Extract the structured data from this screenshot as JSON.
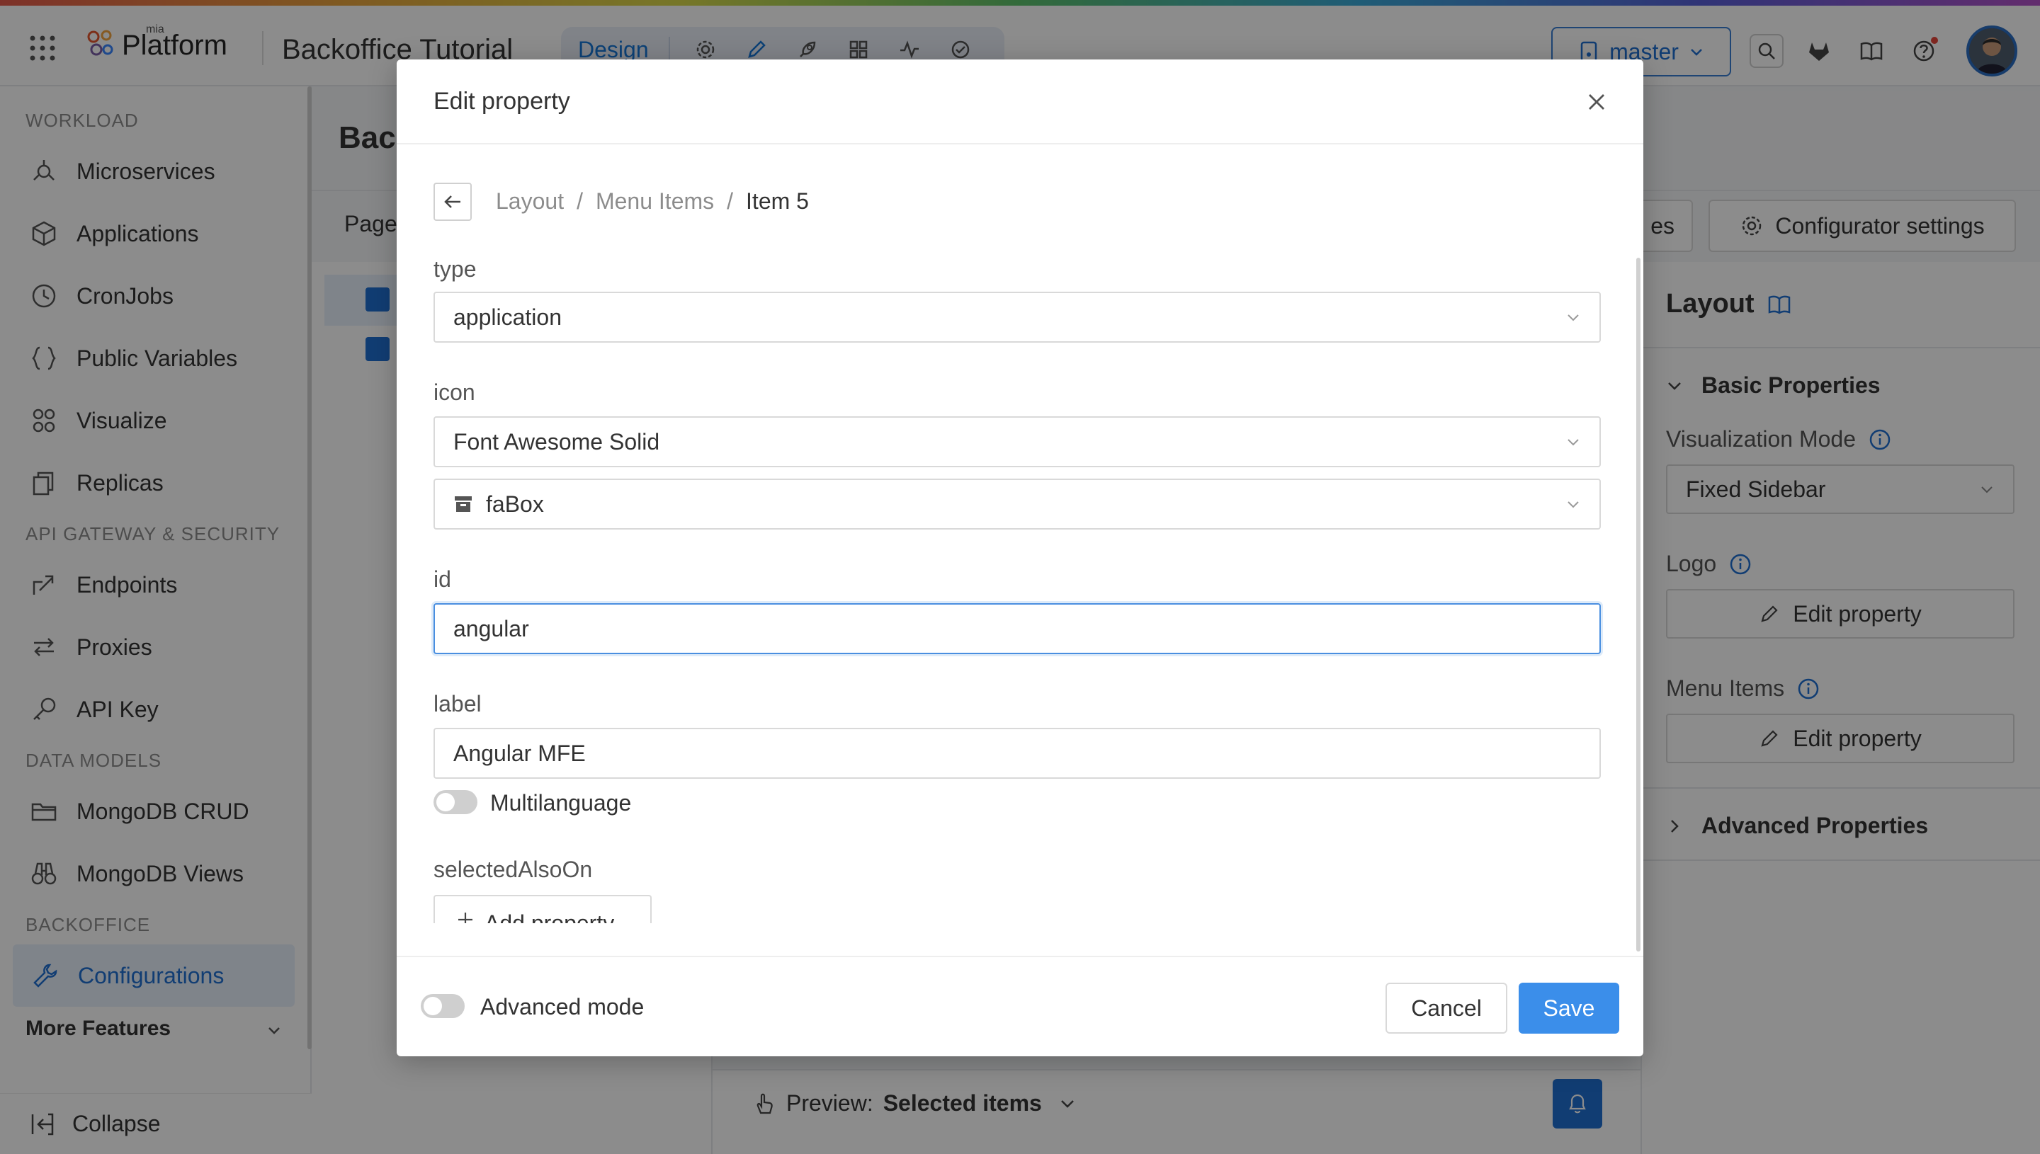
{
  "topbar": {
    "logo_small": "mia",
    "logo_text": "Platform",
    "project_title": "Backoffice Tutorial",
    "mode_label": "Design",
    "branch": "master"
  },
  "sidebar": {
    "sections": [
      {
        "title": "WORKLOAD",
        "items": [
          {
            "label": "Microservices",
            "icon": "microservices-icon"
          },
          {
            "label": "Applications",
            "icon": "cube-icon"
          },
          {
            "label": "CronJobs",
            "icon": "clock-icon"
          },
          {
            "label": "Public Variables",
            "icon": "braces-icon"
          },
          {
            "label": "Visualize",
            "icon": "visualize-icon"
          },
          {
            "label": "Replicas",
            "icon": "copy-icon"
          }
        ]
      },
      {
        "title": "API GATEWAY & SECURITY",
        "items": [
          {
            "label": "Endpoints",
            "icon": "endpoint-icon"
          },
          {
            "label": "Proxies",
            "icon": "swap-icon"
          },
          {
            "label": "API Key",
            "icon": "key-icon"
          }
        ]
      },
      {
        "title": "DATA MODELS",
        "items": [
          {
            "label": "MongoDB CRUD",
            "icon": "folder-icon"
          },
          {
            "label": "MongoDB Views",
            "icon": "binoculars-icon"
          }
        ]
      },
      {
        "title": "BACKOFFICE",
        "items": [
          {
            "label": "Configurations",
            "icon": "wrench-icon",
            "active": true
          }
        ]
      }
    ],
    "more_features": "More Features",
    "collapse": "Collapse"
  },
  "main": {
    "title": "Bac",
    "pages_tab": "Page",
    "partial_button": "es",
    "configurator_settings": "Configurator settings",
    "preview_label": "Preview:",
    "preview_value": "Selected items"
  },
  "right_panel": {
    "title": "Layout",
    "basic_properties": "Basic Properties",
    "visualization_mode_label": "Visualization Mode",
    "visualization_mode_value": "Fixed Sidebar",
    "logo_label": "Logo",
    "logo_button": "Edit property",
    "menu_items_label": "Menu Items",
    "menu_items_button": "Edit property",
    "advanced_properties": "Advanced Properties"
  },
  "modal": {
    "title": "Edit property",
    "breadcrumb": [
      "Layout",
      "/",
      "Menu Items",
      "/",
      "Item 5"
    ],
    "fields": {
      "type_label": "type",
      "type_value": "application",
      "icon_label": "icon",
      "icon_library": "Font Awesome Solid",
      "icon_name": "faBox",
      "id_label": "id",
      "id_value": "angular",
      "label_label": "label",
      "label_value": "Angular MFE",
      "multilanguage": "Multilanguage",
      "selected_also_on": "selectedAlsoOn",
      "add_property": "Add property"
    },
    "footer": {
      "advanced_mode": "Advanced mode",
      "cancel": "Cancel",
      "save": "Save"
    }
  }
}
